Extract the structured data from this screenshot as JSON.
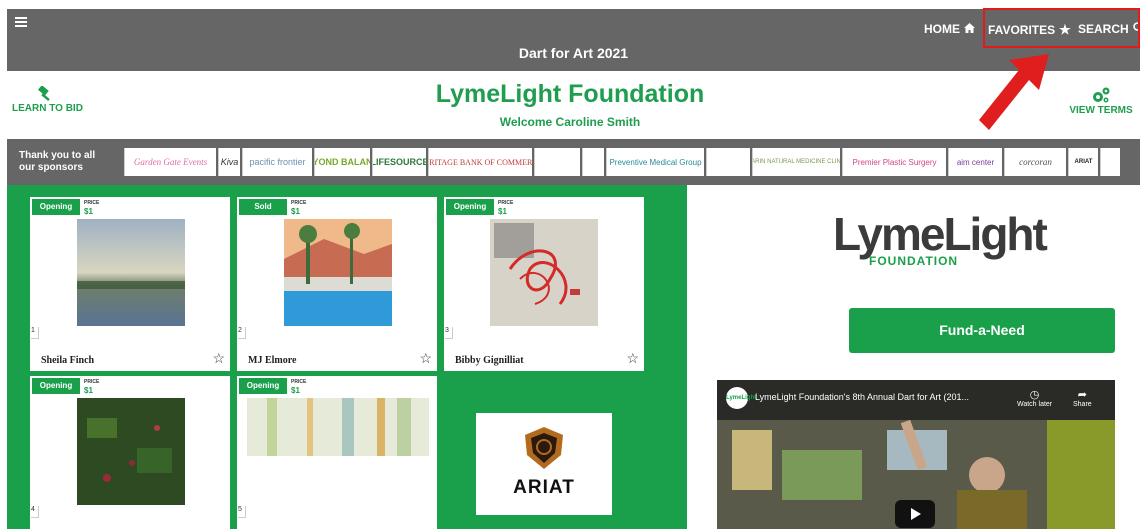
{
  "topbar": {
    "title": "Dart for Art 2021",
    "nav": {
      "home": "HOME",
      "favorites": "FAVORITES",
      "search": "SEARCH"
    }
  },
  "header": {
    "org_title": "LymeLight Foundation",
    "welcome": "Welcome Caroline Smith",
    "learn_to_bid": "LEARN TO BID",
    "view_terms": "VIEW TERMS"
  },
  "sponsors": {
    "label_line1": "Thank you to all",
    "label_line2": "our sponsors",
    "logos": [
      "Garden Gate Events",
      "Kiva",
      "pacific frontier",
      "BEYOND BALANCE",
      "LIFESOURCE",
      "HERITAGE BANK OF COMMERCE",
      "",
      "",
      "Preventive Medical Group",
      "",
      "MARIN NATURAL MEDICINE CLINIC",
      "Premier Plastic Surgery",
      "aim center",
      "corcoran",
      "ARIAT",
      ""
    ]
  },
  "items": [
    {
      "status": "Opening",
      "price_label": "PRICE",
      "price": "$1",
      "lot": "1",
      "artist": "Sheila Finch"
    },
    {
      "status": "Sold",
      "price_label": "PRICE",
      "price": "$1",
      "lot": "2",
      "artist": "MJ Elmore"
    },
    {
      "status": "Opening",
      "price_label": "PRICE",
      "price": "$1",
      "lot": "3",
      "artist": "Bibby Gignilliat"
    },
    {
      "status": "Opening",
      "price_label": "PRICE",
      "price": "$1",
      "lot": "4",
      "artist": ""
    },
    {
      "status": "Opening",
      "price_label": "PRICE",
      "price": "$1",
      "lot": "5",
      "artist": ""
    }
  ],
  "ariat_tile": {
    "text": "ARIAT"
  },
  "right_panel": {
    "logo_main": "LymeLight",
    "logo_sub": "FOUNDATION",
    "fund_button": "Fund-a-Need",
    "video": {
      "channel": "LymeLight",
      "title": "LymeLight Foundation's 8th Annual Dart for Art (201...",
      "watch_later": "Watch later",
      "share": "Share"
    }
  },
  "colors": {
    "brand_green": "#1aa04b",
    "bar_gray": "#666666",
    "highlight_red": "#e11a1a"
  }
}
